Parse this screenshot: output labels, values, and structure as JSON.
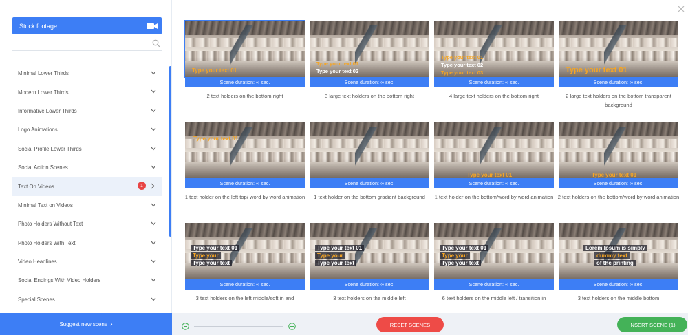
{
  "sidebar": {
    "stock_footage": "Stock footage",
    "search": {
      "placeholder": "",
      "value": ""
    },
    "categories": [
      {
        "label": "Minimal Lower Thirds"
      },
      {
        "label": "Modern Lower Thirds"
      },
      {
        "label": "Informative Lower Thirds"
      },
      {
        "label": "Logo Animations"
      },
      {
        "label": "Social Profile Lower Thirds"
      },
      {
        "label": "Social Action Scenes"
      },
      {
        "label": "Text On Videos",
        "badge": "1",
        "active": true
      },
      {
        "label": "Minimal Text on Videos"
      },
      {
        "label": "Photo Holders Without Text"
      },
      {
        "label": "Photo Holders With Text"
      },
      {
        "label": "Video Headlines"
      },
      {
        "label": "Social Endings With Video Holders"
      },
      {
        "label": "Special Scenes"
      }
    ],
    "suggest_label": "Suggest new scene",
    "suggest_arrow": "›"
  },
  "scenes": [
    {
      "duration": "Scene duration: ∞ sec.",
      "caption": "2 text holders on the bottom right",
      "overlay": [
        "Type your text 01"
      ]
    },
    {
      "duration": "Scene duration: ∞ sec.",
      "caption": "3 large text holders on the bottom right",
      "overlay": [
        "Type your text 01",
        "Type your text 02"
      ]
    },
    {
      "duration": "Scene duration: ∞ sec.",
      "caption": "4 large text holders on the bottom right",
      "overlay": [
        "Type your text 01",
        "Type your text 02",
        "Type your text 03"
      ]
    },
    {
      "duration": "Scene duration: ∞ sec.",
      "caption": "2 large text holders on the bottom transparent background",
      "overlay": [
        "Type your text 01"
      ]
    },
    {
      "duration": "Scene duration: ∞ sec.",
      "caption": "1 text holder on the left top/ word by word animation",
      "overlay": [
        "Type your text 01"
      ]
    },
    {
      "duration": "Scene duration: ∞ sec.",
      "caption": "1 text holder on the bottom gradient background",
      "overlay": []
    },
    {
      "duration": "Scene duration: ∞ sec.",
      "caption": "1 text holder on the bottom/word by word animation",
      "overlay": [
        "Type your text 01"
      ]
    },
    {
      "duration": "Scene duration: ∞ sec.",
      "caption": "2 text holders on the bottom/word by word animation",
      "overlay": [
        "Type your text 01"
      ]
    },
    {
      "duration": "Scene duration: ∞ sec.",
      "caption": "3 text holders on the left middle/soft in and",
      "overlay": [
        "Type your text 01",
        "Type your",
        "Type your text"
      ]
    },
    {
      "duration": "Scene duration: ∞ sec.",
      "caption": "3 text holders on the middle left",
      "overlay": [
        "Type your text 01",
        "Type your",
        "Type your text"
      ]
    },
    {
      "duration": "Scene duration: ∞ sec.",
      "caption": "6 text holders on the middle left / transition in",
      "overlay": [
        "Type your text 01",
        "Type your",
        "Type your text"
      ]
    },
    {
      "duration": "Scene duration: ∞ sec.",
      "caption": "3 text holders on the middle bottom",
      "overlay": [
        "Lorem Ipsum is simply",
        "dummy text",
        "of the printing"
      ]
    }
  ],
  "footer": {
    "reset_label": "RESET SCENES",
    "insert_label": "INSERT SCENE (1)"
  },
  "colors": {
    "accent": "#3d7ef5",
    "reset": "#ee4b47",
    "insert": "#44b258",
    "overlay_orange": "#f5a524"
  },
  "icons": {
    "camera": "video-camera-icon",
    "search": "search-icon",
    "close": "close-icon",
    "zoom_out": "zoom-out-icon",
    "zoom_in": "zoom-in-icon"
  }
}
